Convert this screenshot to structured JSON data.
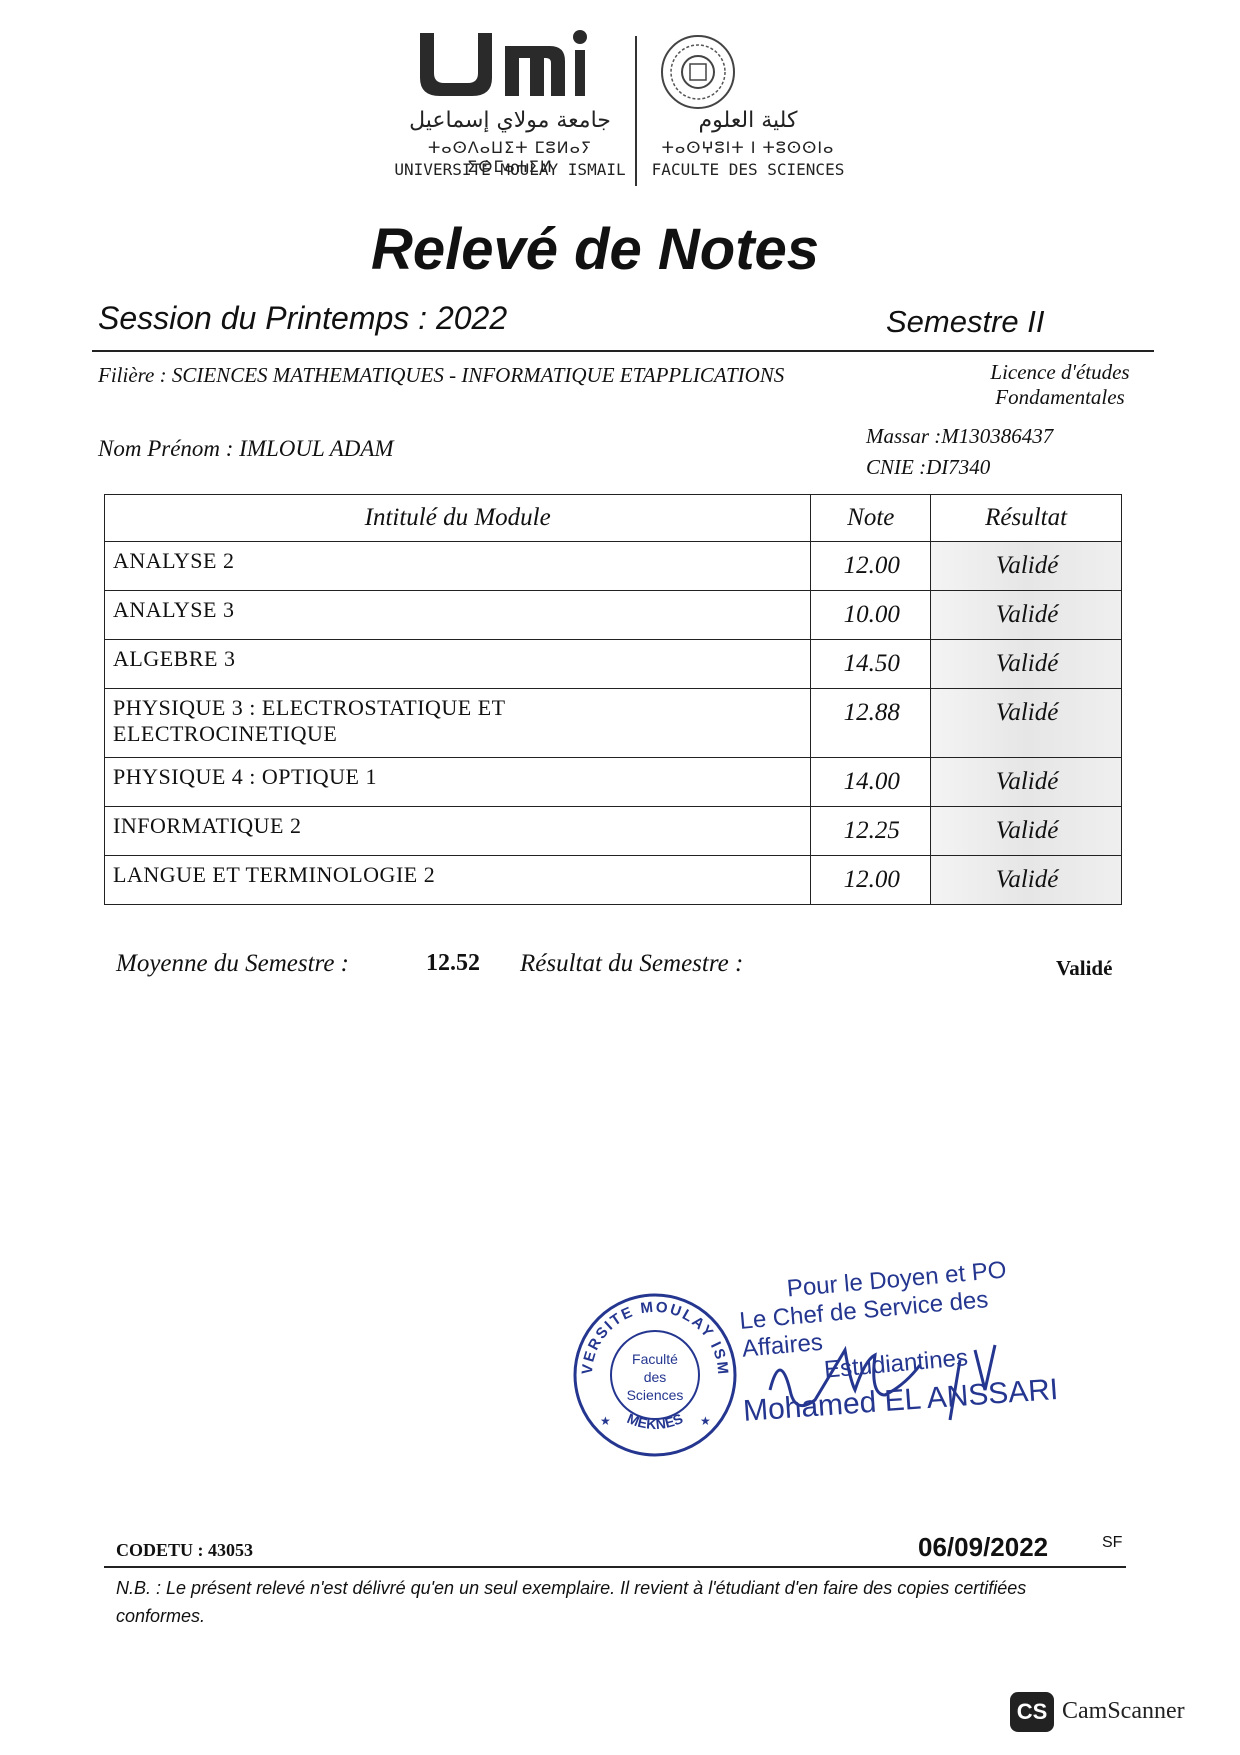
{
  "header": {
    "university_ar": "جامعة مولاي إسماعيل",
    "university_tifinagh": "ⵜⴰⵙⴷⴰⵡⵉⵜ ⵎⵓⵍⴰⵢ ⵉⵙⵎⴰⵄⵉⵍ",
    "university_fr": "UNIVERSITÉ MOULAY ISMAIL",
    "faculty_ar": "كلية العلوم",
    "faculty_tifinagh": "ⵜⴰⵙⵖⵓⵏⵜ ⵏ ⵜⵓⵙⵙⵏⴰ",
    "faculty_fr": "FACULTE DES SCIENCES"
  },
  "title": "Relevé de Notes",
  "session": "Session du Printemps : 2022",
  "semestre": "Semestre II",
  "filiere": "Filière : SCIENCES MATHEMATIQUES - INFORMATIQUE ETAPPLICATIONS",
  "licence_line1": "Licence d'études",
  "licence_line2": "Fondamentales",
  "nom_prenom": "Nom Prénom :  IMLOUL ADAM",
  "massar": "Massar  :M130386437",
  "cnie": "CNIE :DI7340",
  "table": {
    "headers": [
      "Intitulé du Module",
      "Note",
      "Résultat"
    ],
    "rows": [
      {
        "module": "ANALYSE 2",
        "note": "12.00",
        "resultat": "Validé"
      },
      {
        "module": "ANALYSE 3",
        "note": "10.00",
        "resultat": "Validé"
      },
      {
        "module": "ALGEBRE 3",
        "note": "14.50",
        "resultat": "Validé"
      },
      {
        "module": "PHYSIQUE 3 : ELECTROSTATIQUE ET ELECTROCINETIQUE",
        "note": "12.88",
        "resultat": "Validé"
      },
      {
        "module": "PHYSIQUE 4 : OPTIQUE 1",
        "note": "14.00",
        "resultat": "Validé"
      },
      {
        "module": "INFORMATIQUE 2",
        "note": "12.25",
        "resultat": "Validé"
      },
      {
        "module": "LANGUE ET TERMINOLOGIE 2",
        "note": "12.00",
        "resultat": "Validé"
      }
    ]
  },
  "summary": {
    "moyenne_label": "Moyenne du Semestre :",
    "moyenne_value": "12.52",
    "resultat_label": "Résultat du Semestre :",
    "resultat_value": "Validé"
  },
  "stamp": {
    "ring_text": "UNIVERSITE MOULAY ISMAIL",
    "bottom_text": "MEKNES",
    "center_line1": "Faculté",
    "center_line2": "des",
    "center_line3": "Sciences"
  },
  "signature": {
    "line1": "Pour le Doyen et PO",
    "line2": "Le Chef de Service des Affaires",
    "line3": "Estudiantines",
    "name": "Mohamed EL ANSSARI"
  },
  "footer": {
    "codetu": "CODETU : 43053",
    "date": "06/09/2022",
    "sf": "SF",
    "nb": "N.B. : Le présent relevé n'est délivré qu'en un seul exemplaire. Il revient  à l'étudiant d'en faire des copies certifiées conformes."
  },
  "watermark": "CamScanner",
  "colors": {
    "ink": "#111111",
    "stamp_blue": "#24368f"
  }
}
